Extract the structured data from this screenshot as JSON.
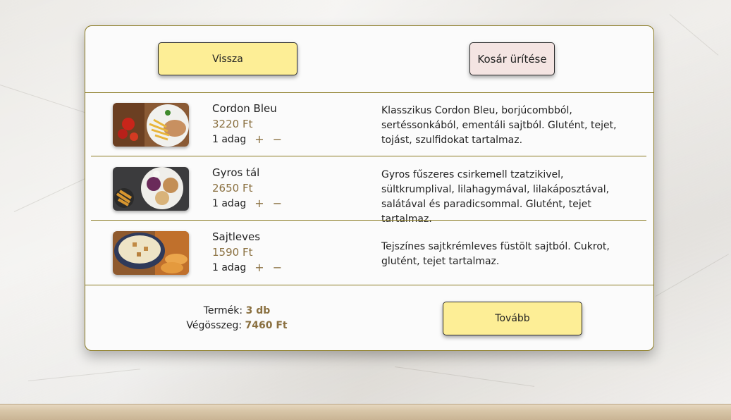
{
  "header": {
    "back_label": "Vissza",
    "clear_label": "Kosár ürítése"
  },
  "items": [
    {
      "name": "Cordon Bleu",
      "price": "3220 Ft",
      "qty": "1 adag",
      "plus": "+",
      "minus": "−",
      "description": "Klasszikus Cordon Bleu, borjúcombból, sertéssonkából, ementáli sajtból. Glutént, tejet, tojást, szulfidokat tartalmaz."
    },
    {
      "name": "Gyros tál",
      "price": "2650 Ft",
      "qty": "1 adag",
      "plus": "+",
      "minus": "−",
      "description": "Gyros fűszeres csirkemell tzatzikivel, sültkrumplival, lilahagymával, lilakáposztával, salátával és paradicsommal. Glutént, tejet tartalmaz."
    },
    {
      "name": "Sajtleves",
      "price": "1590 Ft",
      "qty": "1 adag",
      "plus": "+",
      "minus": "−",
      "description": "Tejszínes sajtkrémleves füstölt sajtból. Cukrot, glutént, tejet tartalmaz."
    }
  ],
  "footer": {
    "count_label": "Termék:",
    "count_value": "3 db",
    "total_label": "Végösszeg:",
    "total_value": "7460 Ft",
    "next_label": "Tovább"
  },
  "colors": {
    "button_yellow": "#fdee96",
    "button_clear": "#f4e4e2",
    "accent": "#8a7040",
    "border": "#8a7a22"
  }
}
